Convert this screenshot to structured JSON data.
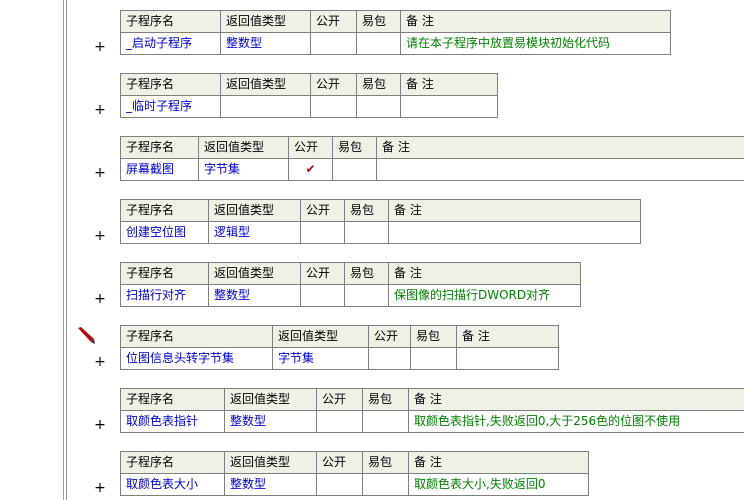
{
  "headers": {
    "name": "子程序名",
    "type": "返回值类型",
    "public": "公开",
    "easy": "易包",
    "note": "备 注"
  },
  "expand_glyph": "+",
  "check_glyph": "✔",
  "subs": [
    {
      "name": "_启动子程序",
      "type": "整数型",
      "public": "",
      "easy": "",
      "note": "请在本子程序中放置易模块初始化代码"
    },
    {
      "name": "_临时子程序",
      "type": "",
      "public": "",
      "easy": "",
      "note": ""
    },
    {
      "name": "屏幕截图",
      "type": "字节集",
      "public": "✔",
      "easy": "",
      "note": ""
    },
    {
      "name": "创建空位图",
      "type": "逻辑型",
      "public": "",
      "easy": "",
      "note": ""
    },
    {
      "name": "扫描行对齐",
      "type": "整数型",
      "public": "",
      "easy": "",
      "note": "保图像的扫描行DWORD对齐"
    },
    {
      "name": "位图信息头转字节集",
      "type": "字节集",
      "public": "",
      "easy": "",
      "note": ""
    },
    {
      "name": "取颜色表指针",
      "type": "整数型",
      "public": "",
      "easy": "",
      "note": "取颜色表指针,失败返回0,大于256色的位图不使用"
    },
    {
      "name": "取颜色表大小",
      "type": "整数型",
      "public": "",
      "easy": "",
      "note": "取颜色表大小,失败返回0"
    }
  ],
  "icons": {
    "edit_marker": "pencil-icon"
  },
  "colors": {
    "header_bg": "#eef1e6",
    "grid": "#7f7f7f",
    "identifier": "#0000cc",
    "note": "#008000",
    "check": "#b00000"
  }
}
